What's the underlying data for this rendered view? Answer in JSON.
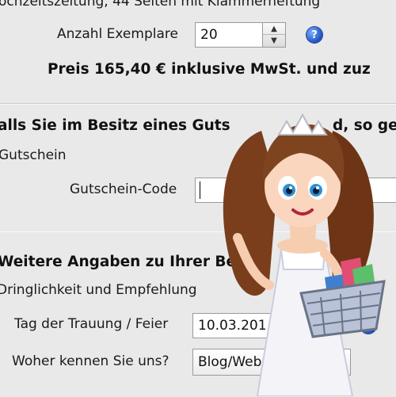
{
  "top": {
    "product_desc": "ochzeitszeitung, 44 Seiten mit Klammerheftung",
    "copies_label": "Anzahl Exemplare",
    "copies_value": "20",
    "up_icon": "triangle-up",
    "down_icon": "triangle-down",
    "help_icon": "?",
    "price_text": "Preis 165,40 € inklusive MwSt. und zuz"
  },
  "voucher": {
    "heading": "alls Sie im Besitz eines Guts",
    "heading_tail": "d, so ge",
    "group_label": "Gutschein",
    "code_label": "Gutschein-Code",
    "code_value": ""
  },
  "details": {
    "heading": "Weitere Angaben zu Ihrer Bes",
    "group_label": "Dringlichkeit und Empfehlung",
    "date_label": "Tag der Trauung / Feier",
    "date_value": "10.03.201",
    "help_icon": "?",
    "source_label": "Woher kennen Sie uns?",
    "source_value": "Blog/Web"
  },
  "colors": {
    "panel": "#e9e9e9",
    "help_blue": "#1d4fbf"
  }
}
